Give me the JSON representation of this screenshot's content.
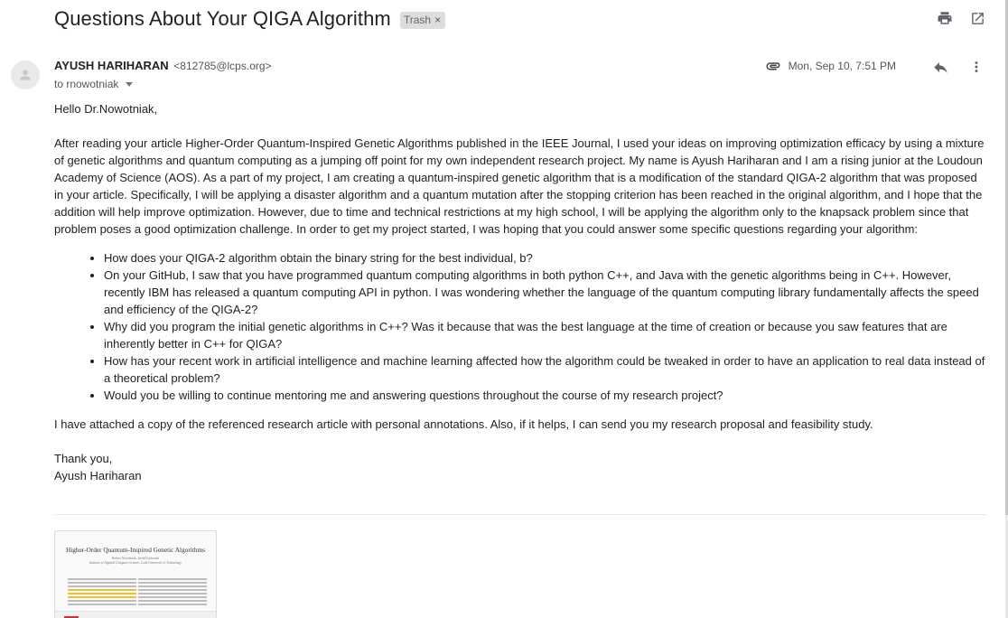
{
  "subject": "Questions About Your QIGA Algorithm",
  "label": {
    "text": "Trash",
    "remove_glyph": "×"
  },
  "icons": {
    "print": "print-icon",
    "popout": "open-in-new-icon",
    "attachment": "paperclip-icon",
    "reply": "reply-icon",
    "more": "more-vert-icon",
    "avatar": "person-icon"
  },
  "sender": {
    "name": "AYUSH HARIHARAN",
    "email": "<812785@lcps.org>"
  },
  "recipient": "to rnowotniak",
  "date": "Mon, Sep 10, 7:51 PM",
  "body": {
    "greeting": "Hello Dr.Nowotniak,",
    "intro": "After reading your article Higher-Order Quantum-Inspired Genetic Algorithms published in the IEEE Journal, I used your ideas on improving optimization efficacy by using a mixture of genetic algorithms and quantum computing as a jumping off point for my own independent research project. My name is Ayush Hariharan and I am a rising junior at the Loudoun Academy of Science (AOS). As a part of my project, I am creating a quantum-inspired genetic algorithm that is a modification of the standard QIGA-2 algorithm that was proposed in your article. Specifically, I will be applying a disaster algorithm and a quantum mutation after the stopping criterion has been reached in the original algorithm, and I hope that the addition will help improve optimization. However, due to time and technical restrictions at my high school, I will be applying the algorithm only to the knapsack problem since that problem poses a good optimization challenge. In order to get my project started, I was hoping that you could answer some specific questions regarding your algorithm:",
    "questions": [
      "How does your QIGA-2 algorithm obtain the binary string for the best individual, b?",
      "On your GitHub, I saw that you have programmed quantum computing algorithms in both python C++, and Java with the genetic algorithms being in C++. However, recently IBM has released a quantum computing API in python. I was wondering whether the language of the quantum computing library fundamentally affects the speed and efficiency of the QIGA-2?",
      "Why did you program the initial genetic algorithms in C++? Was it because that was the best language at the time of creation or because you saw features that are inherently better in C++ for QIGA?",
      "How has your recent work in artificial intelligence and machine learning affected how the algorithm could be tweaked in order to have an application to real data instead of a theoretical problem?",
      "Would you be willing to continue mentoring me and answering questions throughout the course of my research project?"
    ],
    "closing_para": "I have attached a copy of the referenced research article with personal annotations. Also, if it helps, I can send you my research proposal and feasibility study.",
    "signoff": "Thank you,",
    "signature": "Ayush Hariharan"
  },
  "attachment": {
    "title": "Higher-Order Quantum-Inspired Genetic Algorithms",
    "authors": "Robert Nowotniak, Jacek Kucharski",
    "affiliation": "Institute of Applied Computer Science, Lodz University of Technology"
  }
}
